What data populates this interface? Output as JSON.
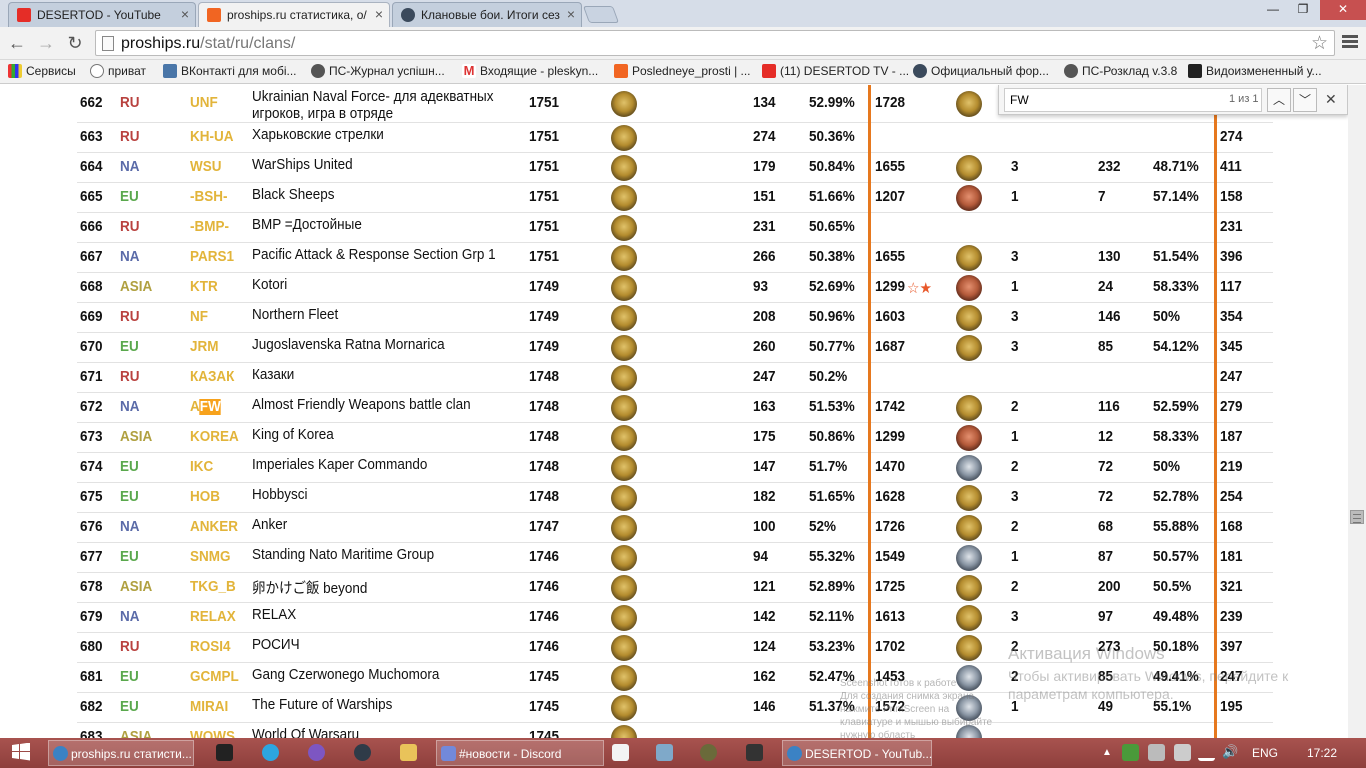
{
  "tabs": [
    {
      "title": "DESERTOD - YouTube",
      "icon": "youtube-icon"
    },
    {
      "title": "proships.ru статистика, о/",
      "icon": "proships-icon",
      "active": true
    },
    {
      "title": "Клановые бои. Итоги сез",
      "icon": "wows-icon"
    }
  ],
  "address": {
    "host": "proships.ru",
    "path": "/stat/ru/clans/"
  },
  "bookmarks": [
    {
      "label": "Сервисы"
    },
    {
      "label": "приват"
    },
    {
      "label": "ВКонтакті для мобі..."
    },
    {
      "label": "ПС-Журнал успішн..."
    },
    {
      "label": "Входящие - pleskyn..."
    },
    {
      "label": "Posledneye_prosti | ..."
    },
    {
      "label": "(11) DESERTOD TV - ..."
    },
    {
      "label": "Официальный фор..."
    },
    {
      "label": "ПС-Розклад v.3.8"
    },
    {
      "label": "Видоизмененный у..."
    }
  ],
  "find": {
    "query": "FW",
    "count": "1 из 1"
  },
  "rows": [
    {
      "n": "662",
      "region": "RU",
      "tag": "UNF",
      "name": "Ukrainian Naval Force- для адекватных",
      "name2": "игроков, игра в отряде",
      "rating": "1751",
      "league": "2",
      "battles": "134",
      "win": "52.99%",
      "rating2": "1728",
      "medal2": "gold",
      "league2": "",
      "battles2": "",
      "win2": "",
      "total": ""
    },
    {
      "n": "663",
      "region": "RU",
      "tag": "KH-UA",
      "name": "Харьковские стрелки",
      "rating": "1751",
      "league": "2",
      "battles": "274",
      "win": "50.36%",
      "rating2": "",
      "medal2": "",
      "league2": "",
      "battles2": "",
      "win2": "",
      "total": "274"
    },
    {
      "n": "664",
      "region": "NA",
      "tag": "WSU",
      "name": "WarShips United",
      "rating": "1751",
      "league": "2",
      "battles": "179",
      "win": "50.84%",
      "rating2": "1655",
      "medal2": "gold",
      "league2": "3",
      "battles2": "232",
      "win2": "48.71%",
      "total": "411"
    },
    {
      "n": "665",
      "region": "EU",
      "tag": "-BSH-",
      "name": "Black Sheeps",
      "rating": "1751",
      "league": "2",
      "battles": "151",
      "win": "51.66%",
      "rating2": "1207",
      "medal2": "bronze",
      "league2": "1",
      "battles2": "7",
      "win2": "57.14%",
      "total": "158"
    },
    {
      "n": "666",
      "region": "RU",
      "tag": "-BMP-",
      "name": "BMP =Достойные",
      "rating": "1751",
      "league": "2",
      "battles": "231",
      "win": "50.65%",
      "rating2": "",
      "medal2": "",
      "league2": "",
      "battles2": "",
      "win2": "",
      "total": "231"
    },
    {
      "n": "667",
      "region": "NA",
      "tag": "PARS1",
      "name": "Pacific Attack & Response Section Grp 1",
      "rating": "1751",
      "league": "2",
      "battles": "266",
      "win": "50.38%",
      "rating2": "1655",
      "medal2": "gold",
      "league2": "3",
      "battles2": "130",
      "win2": "51.54%",
      "total": "396"
    },
    {
      "n": "668",
      "region": "ASIA",
      "tag": "KTR",
      "name": "Kotori",
      "rating": "1749",
      "league": "2",
      "battles": "93",
      "win": "52.69%",
      "rating2": "1299",
      "stars": "☆★",
      "medal2": "bronze",
      "league2": "1",
      "battles2": "24",
      "win2": "58.33%",
      "total": "117"
    },
    {
      "n": "669",
      "region": "RU",
      "tag": "NF",
      "name": "Northern Fleet",
      "rating": "1749",
      "league": "2",
      "battles": "208",
      "win": "50.96%",
      "rating2": "1603",
      "medal2": "gold",
      "league2": "3",
      "battles2": "146",
      "win2": "50%",
      "total": "354"
    },
    {
      "n": "670",
      "region": "EU",
      "tag": "JRM",
      "name": "Jugoslavenska Ratna Mornarica",
      "rating": "1749",
      "league": "2",
      "battles": "260",
      "win": "50.77%",
      "rating2": "1687",
      "medal2": "gold",
      "league2": "3",
      "battles2": "85",
      "win2": "54.12%",
      "total": "345"
    },
    {
      "n": "671",
      "region": "RU",
      "tag": "КАЗАК",
      "name": "Казаки",
      "rating": "1748",
      "league": "2",
      "battles": "247",
      "win": "50.2%",
      "rating2": "",
      "medal2": "",
      "league2": "",
      "battles2": "",
      "win2": "",
      "total": "247"
    },
    {
      "n": "672",
      "region": "NA",
      "tag": "A",
      "tag_hl": "FW",
      "name": "Almost Friendly Weapons battle clan",
      "rating": "1748",
      "league": "2",
      "battles": "163",
      "win": "51.53%",
      "rating2": "1742",
      "medal2": "gold",
      "league2": "2",
      "battles2": "116",
      "win2": "52.59%",
      "total": "279"
    },
    {
      "n": "673",
      "region": "ASIA",
      "tag": "KOREA",
      "name": "King of Korea",
      "rating": "1748",
      "league": "2",
      "battles": "175",
      "win": "50.86%",
      "rating2": "1299",
      "medal2": "bronze",
      "league2": "1",
      "battles2": "12",
      "win2": "58.33%",
      "total": "187"
    },
    {
      "n": "674",
      "region": "EU",
      "tag": "IKC",
      "name": "Imperiales Kaper Commando",
      "rating": "1748",
      "league": "2",
      "battles": "147",
      "win": "51.7%",
      "rating2": "1470",
      "medal2": "silver",
      "league2": "2",
      "battles2": "72",
      "win2": "50%",
      "total": "219"
    },
    {
      "n": "675",
      "region": "EU",
      "tag": "HOB",
      "name": "Hobbysci",
      "rating": "1748",
      "league": "2",
      "battles": "182",
      "win": "51.65%",
      "rating2": "1628",
      "medal2": "gold",
      "league2": "3",
      "battles2": "72",
      "win2": "52.78%",
      "total": "254"
    },
    {
      "n": "676",
      "region": "NA",
      "tag": "ANKER",
      "name": "Anker",
      "rating": "1747",
      "league": "2",
      "battles": "100",
      "win": "52%",
      "rating2": "1726",
      "medal2": "gold",
      "league2": "2",
      "battles2": "68",
      "win2": "55.88%",
      "total": "168"
    },
    {
      "n": "677",
      "region": "EU",
      "tag": "SNMG",
      "name": "Standing Nato Maritime Group",
      "rating": "1746",
      "league": "2",
      "battles": "94",
      "win": "55.32%",
      "rating2": "1549",
      "medal2": "silver",
      "league2": "1",
      "battles2": "87",
      "win2": "50.57%",
      "total": "181"
    },
    {
      "n": "678",
      "region": "ASIA",
      "tag": "TKG_B",
      "name": "卵かけご飯 beyond",
      "rating": "1746",
      "league": "2",
      "battles": "121",
      "win": "52.89%",
      "rating2": "1725",
      "medal2": "gold",
      "league2": "2",
      "battles2": "200",
      "win2": "50.5%",
      "total": "321"
    },
    {
      "n": "679",
      "region": "NA",
      "tag": "RELAX",
      "name": "RELAX",
      "rating": "1746",
      "league": "2",
      "battles": "142",
      "win": "52.11%",
      "rating2": "1613",
      "medal2": "gold",
      "league2": "3",
      "battles2": "97",
      "win2": "49.48%",
      "total": "239"
    },
    {
      "n": "680",
      "region": "RU",
      "tag": "ROSI4",
      "name": "РОСИЧ",
      "rating": "1746",
      "league": "2",
      "battles": "124",
      "win": "53.23%",
      "rating2": "1702",
      "medal2": "gold",
      "league2": "2",
      "battles2": "273",
      "win2": "50.18%",
      "total": "397"
    },
    {
      "n": "681",
      "region": "EU",
      "tag": "GCMPL",
      "name": "Gang Czerwonego Muchomora",
      "rating": "1745",
      "league": "2",
      "battles": "162",
      "win": "52.47%",
      "rating2": "1453",
      "medal2": "silver",
      "league2": "2",
      "battles2": "85",
      "win2": "49.41%",
      "total": "247"
    },
    {
      "n": "682",
      "region": "EU",
      "tag": "MIRAI",
      "name": "The Future of Warships",
      "rating": "1745",
      "league": "2",
      "battles": "146",
      "win": "51.37%",
      "rating2": "1572",
      "medal2": "silver",
      "league2": "1",
      "battles2": "49",
      "win2": "55.1%",
      "total": "195"
    },
    {
      "n": "683",
      "region": "ASIA",
      "tag": "WOWS",
      "name": "World Of Warsaru",
      "rating": "1745",
      "league": "2",
      "battles": "",
      "win": "",
      "rating2": "",
      "medal2": "silver",
      "league2": "",
      "battles2": "",
      "win2": "",
      "total": ""
    }
  ],
  "watermark": {
    "title": "Активация Windows",
    "line1": "Чтобы активировать Windows, перейдите к",
    "line2": "параметрам компьютера."
  },
  "toast": {
    "line1": "Sceenshot готов к работе",
    "line2": "Для создания снимка экрана нажмите PrintScreen на",
    "line3": "клавиатуре и мышью выбирайте нужную область"
  },
  "taskbar": {
    "items": [
      {
        "label": "proships.ru статисти...",
        "icon": "chrome-icon"
      },
      {
        "label": "#новости - Discord",
        "icon": "discord-icon"
      },
      {
        "label": "DESERTOD - YouTub...",
        "icon": "chrome-icon"
      }
    ],
    "lang": "ENG",
    "clock": "17:22"
  }
}
